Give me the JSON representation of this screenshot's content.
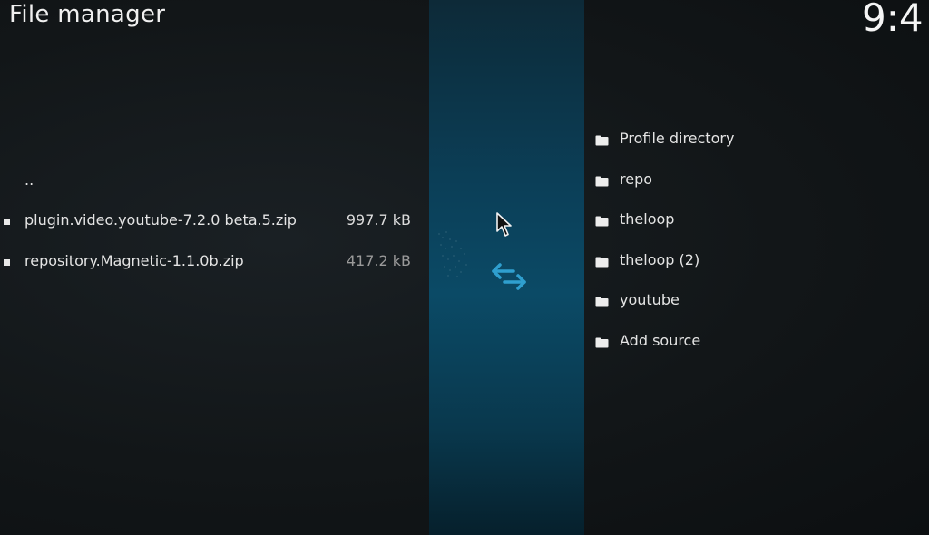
{
  "header": {
    "title": "File manager",
    "clock": "9:4"
  },
  "left_pane": {
    "parent_dir": "..",
    "files": [
      {
        "name": "plugin.video.youtube-7.2.0 beta.5.zip",
        "size": "997.7 kB"
      },
      {
        "name": "repository.Magnetic-1.1.0b.zip",
        "size": "417.2 kB"
      }
    ]
  },
  "right_pane": {
    "sources": [
      {
        "label": "Profile directory"
      },
      {
        "label": "repo"
      },
      {
        "label": "theloop"
      },
      {
        "label": "theloop (2)"
      },
      {
        "label": "youtube"
      },
      {
        "label": "Add source"
      }
    ]
  },
  "icons": {
    "folder": "folder-icon",
    "swap": "swap-arrows-icon",
    "cursor": "mouse-pointer-icon",
    "bullet": "file-bullet-icon"
  },
  "colors": {
    "accent": "#2f9fcf",
    "center_panel": "#0b4a66",
    "background": "#121618"
  }
}
